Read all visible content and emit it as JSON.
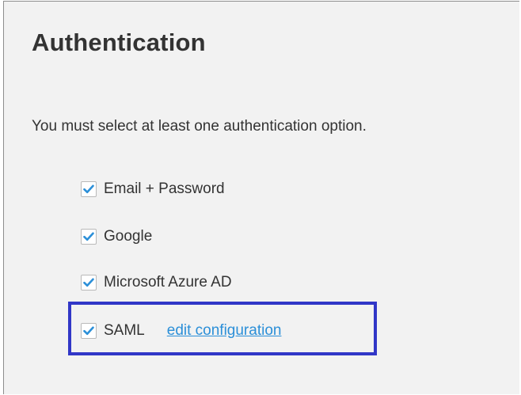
{
  "auth": {
    "title": "Authentication",
    "instructions": "You must select at least one authentication option.",
    "options": [
      {
        "label": "Email + Password",
        "checked": true
      },
      {
        "label": "Google",
        "checked": true
      },
      {
        "label": "Microsoft Azure AD",
        "checked": true
      },
      {
        "label": "SAML",
        "checked": true,
        "link": "edit configuration"
      }
    ]
  },
  "icons": {
    "checkmark": "check-icon"
  },
  "colors": {
    "panel_background": "#f2f2f2",
    "text": "#333333",
    "checkmark": "#2b8fd8",
    "link": "#2b8fd8",
    "highlight_border": "#3137c7"
  }
}
